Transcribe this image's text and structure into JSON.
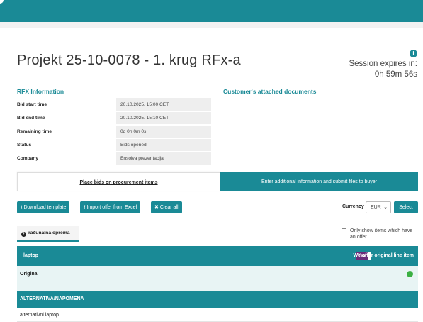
{
  "header": {
    "title": "Projekt 25-10-0078 - 1. krug RFx-a"
  },
  "session": {
    "label": "Session expires in:",
    "value": "0h 59m 56s",
    "info_icon": "info-icon"
  },
  "rfx": {
    "heading": "RFX Information",
    "rows": [
      {
        "label": "Bid start time",
        "value": "20.10.2025. 15:00 CET"
      },
      {
        "label": "Bid end time",
        "value": "20.10.2025. 15:10 CET"
      },
      {
        "label": "Remaining time",
        "value": "0d 0h 0m 0s"
      },
      {
        "label": "Status",
        "value": "Bids opened"
      },
      {
        "label": "Company",
        "value": "Ensolva prezentacija"
      }
    ]
  },
  "documents": {
    "heading": "Customer's attached documents"
  },
  "tabs": {
    "place_bids": "Place bids on procurement items",
    "additional_info": "Enter additional information and submit files to buyer"
  },
  "toolbar": {
    "download_template": "Download template",
    "import_excel": "Import offer from Excel",
    "clear_all": "Clear all",
    "currency_label": "Currency",
    "currency_value": "EUR",
    "select_button": "Select"
  },
  "category": {
    "name": "računalna oprema"
  },
  "filter": {
    "only_show_offer": "Only show items which have an offer"
  },
  "items": {
    "laptop_header": "laptop",
    "yes_label": "Yes",
    "offer_original_label": "We offer original line item",
    "original_row": "Original",
    "alternative_header": "ALTERNATIVA/NAPOMENA",
    "alternative_row": "alternativni laptop"
  },
  "colors": {
    "accent": "#1a8a96",
    "toggle": "#6b2d7a",
    "add": "#3cb043"
  }
}
